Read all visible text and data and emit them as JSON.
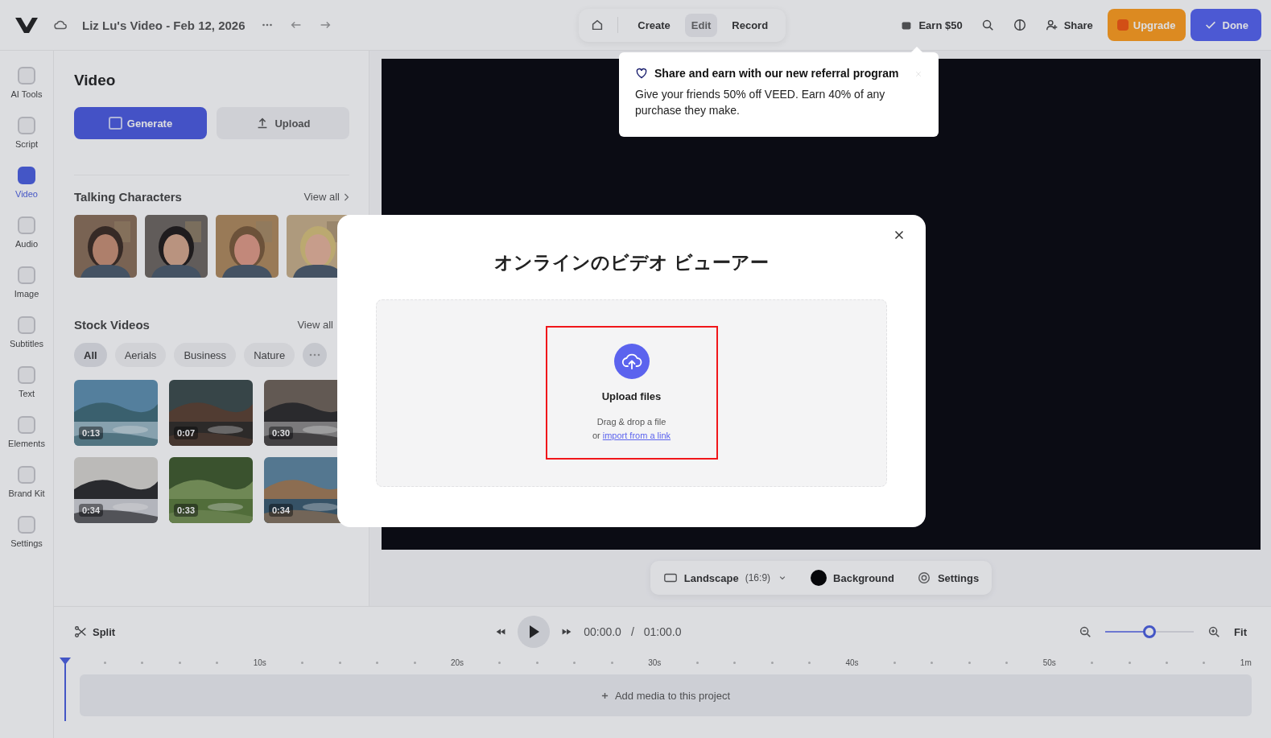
{
  "topbar": {
    "project_title": "Liz Lu's Video - Feb 12, 2026",
    "modes": [
      {
        "label": "Create",
        "selected": false
      },
      {
        "label": "Edit",
        "selected": true
      },
      {
        "label": "Record",
        "selected": false
      }
    ],
    "earn": "Earn $50",
    "share": "Share",
    "upgrade": "Upgrade",
    "done": "Done"
  },
  "rail": [
    {
      "label": "AI Tools",
      "selected": false
    },
    {
      "label": "Script",
      "selected": false
    },
    {
      "label": "Video",
      "selected": true
    },
    {
      "label": "Audio",
      "selected": false
    },
    {
      "label": "Image",
      "selected": false
    },
    {
      "label": "Subtitles",
      "selected": false
    },
    {
      "label": "Text",
      "selected": false
    },
    {
      "label": "Elements",
      "selected": false
    },
    {
      "label": "Brand Kit",
      "selected": false
    },
    {
      "label": "Settings",
      "selected": false
    }
  ],
  "panel": {
    "title": "Video",
    "generate": "Generate",
    "upload": "Upload",
    "talking_characters": {
      "title": "Talking Characters",
      "view_all": "View all"
    },
    "stock_videos": {
      "title": "Stock Videos",
      "view_all": "View all",
      "filters": [
        {
          "label": "All",
          "selected": true
        },
        {
          "label": "Aerials",
          "selected": false
        },
        {
          "label": "Business",
          "selected": false
        },
        {
          "label": "Nature",
          "selected": false
        }
      ],
      "videos": [
        {
          "duration": "0:13"
        },
        {
          "duration": "0:07"
        },
        {
          "duration": "0:30"
        },
        {
          "duration": "0:34"
        },
        {
          "duration": "0:33"
        },
        {
          "duration": "0:34"
        }
      ]
    }
  },
  "canvas_bar": {
    "aspect": "Landscape",
    "aspect_detail": "(16:9)",
    "background": "Background",
    "settings": "Settings"
  },
  "timeline": {
    "split": "Split",
    "time": "00:00.0",
    "separator": "/",
    "duration": "01:00.0",
    "zoom": {
      "level": 0.5
    },
    "fit": "Fit",
    "ruler": [
      "10s",
      "20s",
      "30s",
      "40s",
      "50s",
      "1m"
    ],
    "empty_track": "Add media to this project"
  },
  "tooltip": {
    "title": "Share and earn with our new referral program",
    "body": "Give your friends 50% off VEED. Earn 40% of any purchase they make."
  },
  "modal": {
    "title": "オンラインのビデオ ビューアー",
    "upload_title": "Upload files",
    "hint": "Drag & drop a file",
    "or": "or",
    "link": "import from a link"
  }
}
